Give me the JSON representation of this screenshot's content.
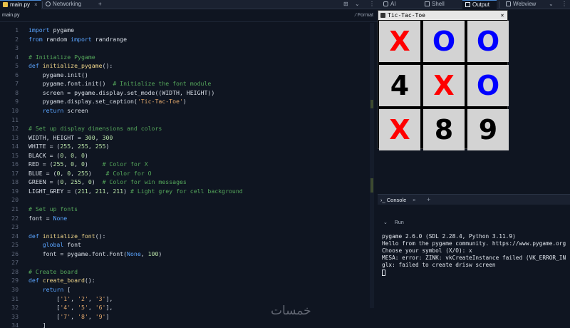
{
  "tabs_left": [
    {
      "label": "main.py",
      "active": true
    },
    {
      "label": "Networking",
      "active": false
    }
  ],
  "tab_add": "+",
  "tabs_right": [
    {
      "label": "AI"
    },
    {
      "label": "Shell"
    },
    {
      "label": "Output"
    },
    {
      "label": "Webview"
    }
  ],
  "tab_close": "×",
  "editor": {
    "file_name": "main.py",
    "format_label": "Format",
    "lines": [
      {
        "n": "1",
        "tokens": [
          {
            "t": "import",
            "c": "kw"
          },
          {
            "t": " pygame",
            "c": ""
          }
        ]
      },
      {
        "n": "2",
        "tokens": [
          {
            "t": "from",
            "c": "kw"
          },
          {
            "t": " random ",
            "c": ""
          },
          {
            "t": "import",
            "c": "kw"
          },
          {
            "t": " randrange",
            "c": ""
          }
        ]
      },
      {
        "n": "3",
        "tokens": []
      },
      {
        "n": "4",
        "tokens": [
          {
            "t": "# Initialize Pygame",
            "c": "cm"
          }
        ]
      },
      {
        "n": "5",
        "tokens": [
          {
            "t": "def",
            "c": "kw"
          },
          {
            "t": " initialize_pygame",
            "c": "fn"
          },
          {
            "t": "():",
            "c": ""
          }
        ]
      },
      {
        "n": "6",
        "tokens": [
          {
            "t": "    pygame.init()",
            "c": ""
          }
        ]
      },
      {
        "n": "7",
        "tokens": [
          {
            "t": "    pygame.font.init()  ",
            "c": ""
          },
          {
            "t": "# Initialize the font module",
            "c": "cm"
          }
        ]
      },
      {
        "n": "8",
        "tokens": [
          {
            "t": "    screen = pygame.display.set_mode((WIDTH, HEIGHT))",
            "c": ""
          }
        ]
      },
      {
        "n": "9",
        "tokens": [
          {
            "t": "    pygame.display.set_caption(",
            "c": ""
          },
          {
            "t": "'Tic-Tac-Toe'",
            "c": "st"
          },
          {
            "t": ")",
            "c": ""
          }
        ]
      },
      {
        "n": "10",
        "tokens": [
          {
            "t": "    ",
            "c": ""
          },
          {
            "t": "return",
            "c": "kw"
          },
          {
            "t": " screen",
            "c": ""
          }
        ]
      },
      {
        "n": "11",
        "tokens": []
      },
      {
        "n": "12",
        "tokens": [
          {
            "t": "# Set up display dimensions and colors",
            "c": "cm"
          }
        ]
      },
      {
        "n": "13",
        "tokens": [
          {
            "t": "WIDTH, HEIGHT = ",
            "c": ""
          },
          {
            "t": "300",
            "c": "nm"
          },
          {
            "t": ", ",
            "c": ""
          },
          {
            "t": "300",
            "c": "nm"
          }
        ]
      },
      {
        "n": "14",
        "tokens": [
          {
            "t": "WHITE = (",
            "c": ""
          },
          {
            "t": "255",
            "c": "nm"
          },
          {
            "t": ", ",
            "c": ""
          },
          {
            "t": "255",
            "c": "nm"
          },
          {
            "t": ", ",
            "c": ""
          },
          {
            "t": "255",
            "c": "nm"
          },
          {
            "t": ")",
            "c": ""
          }
        ]
      },
      {
        "n": "15",
        "tokens": [
          {
            "t": "BLACK = (",
            "c": ""
          },
          {
            "t": "0",
            "c": "nm"
          },
          {
            "t": ", ",
            "c": ""
          },
          {
            "t": "0",
            "c": "nm"
          },
          {
            "t": ", ",
            "c": ""
          },
          {
            "t": "0",
            "c": "nm"
          },
          {
            "t": ")",
            "c": ""
          }
        ]
      },
      {
        "n": "16",
        "tokens": [
          {
            "t": "RED = (",
            "c": ""
          },
          {
            "t": "255",
            "c": "nm"
          },
          {
            "t": ", ",
            "c": ""
          },
          {
            "t": "0",
            "c": "nm"
          },
          {
            "t": ", ",
            "c": ""
          },
          {
            "t": "0",
            "c": "nm"
          },
          {
            "t": ")    ",
            "c": ""
          },
          {
            "t": "# Color for X",
            "c": "cm"
          }
        ]
      },
      {
        "n": "17",
        "tokens": [
          {
            "t": "BLUE = (",
            "c": ""
          },
          {
            "t": "0",
            "c": "nm"
          },
          {
            "t": ", ",
            "c": ""
          },
          {
            "t": "0",
            "c": "nm"
          },
          {
            "t": ", ",
            "c": ""
          },
          {
            "t": "255",
            "c": "nm"
          },
          {
            "t": ")    ",
            "c": ""
          },
          {
            "t": "# Color for O",
            "c": "cm"
          }
        ]
      },
      {
        "n": "18",
        "tokens": [
          {
            "t": "GREEN = (",
            "c": ""
          },
          {
            "t": "0",
            "c": "nm"
          },
          {
            "t": ", ",
            "c": ""
          },
          {
            "t": "255",
            "c": "nm"
          },
          {
            "t": ", ",
            "c": ""
          },
          {
            "t": "0",
            "c": "nm"
          },
          {
            "t": ")  ",
            "c": ""
          },
          {
            "t": "# Color for win messages",
            "c": "cm"
          }
        ]
      },
      {
        "n": "19",
        "tokens": [
          {
            "t": "LIGHT_GREY = (",
            "c": ""
          },
          {
            "t": "211",
            "c": "nm"
          },
          {
            "t": ", ",
            "c": ""
          },
          {
            "t": "211",
            "c": "nm"
          },
          {
            "t": ", ",
            "c": ""
          },
          {
            "t": "211",
            "c": "nm"
          },
          {
            "t": ") ",
            "c": ""
          },
          {
            "t": "# Light grey for cell background",
            "c": "cm"
          }
        ]
      },
      {
        "n": "20",
        "tokens": []
      },
      {
        "n": "21",
        "tokens": [
          {
            "t": "# Set up fonts",
            "c": "cm"
          }
        ]
      },
      {
        "n": "22",
        "tokens": [
          {
            "t": "font = ",
            "c": ""
          },
          {
            "t": "None",
            "c": "kw"
          }
        ]
      },
      {
        "n": "23",
        "tokens": []
      },
      {
        "n": "24",
        "tokens": [
          {
            "t": "def",
            "c": "kw"
          },
          {
            "t": " initialize_font",
            "c": "fn"
          },
          {
            "t": "():",
            "c": ""
          }
        ]
      },
      {
        "n": "25",
        "tokens": [
          {
            "t": "    ",
            "c": ""
          },
          {
            "t": "global",
            "c": "kw"
          },
          {
            "t": " font",
            "c": ""
          }
        ]
      },
      {
        "n": "26",
        "tokens": [
          {
            "t": "    font = pygame.font.Font(",
            "c": ""
          },
          {
            "t": "None",
            "c": "kw"
          },
          {
            "t": ", ",
            "c": ""
          },
          {
            "t": "100",
            "c": "nm"
          },
          {
            "t": ")",
            "c": ""
          }
        ]
      },
      {
        "n": "27",
        "tokens": []
      },
      {
        "n": "28",
        "tokens": [
          {
            "t": "# Create board",
            "c": "cm"
          }
        ]
      },
      {
        "n": "29",
        "tokens": [
          {
            "t": "def",
            "c": "kw"
          },
          {
            "t": " create_board",
            "c": "fn"
          },
          {
            "t": "():",
            "c": ""
          }
        ]
      },
      {
        "n": "30",
        "tokens": [
          {
            "t": "    ",
            "c": ""
          },
          {
            "t": "return",
            "c": "kw"
          },
          {
            "t": " [",
            "c": ""
          }
        ]
      },
      {
        "n": "31",
        "tokens": [
          {
            "t": "        [",
            "c": ""
          },
          {
            "t": "'1'",
            "c": "st"
          },
          {
            "t": ", ",
            "c": ""
          },
          {
            "t": "'2'",
            "c": "st"
          },
          {
            "t": ", ",
            "c": ""
          },
          {
            "t": "'3'",
            "c": "st"
          },
          {
            "t": "],",
            "c": ""
          }
        ]
      },
      {
        "n": "32",
        "tokens": [
          {
            "t": "        [",
            "c": ""
          },
          {
            "t": "'4'",
            "c": "st"
          },
          {
            "t": ", ",
            "c": ""
          },
          {
            "t": "'5'",
            "c": "st"
          },
          {
            "t": ", ",
            "c": ""
          },
          {
            "t": "'6'",
            "c": "st"
          },
          {
            "t": "],",
            "c": ""
          }
        ]
      },
      {
        "n": "33",
        "tokens": [
          {
            "t": "        [",
            "c": ""
          },
          {
            "t": "'7'",
            "c": "st"
          },
          {
            "t": ", ",
            "c": ""
          },
          {
            "t": "'8'",
            "c": "st"
          },
          {
            "t": ", ",
            "c": ""
          },
          {
            "t": "'9'",
            "c": "st"
          },
          {
            "t": "]",
            "c": ""
          }
        ]
      },
      {
        "n": "34",
        "tokens": [
          {
            "t": "    ]",
            "c": ""
          }
        ]
      }
    ]
  },
  "game": {
    "title": "Tic-Tac-Toe",
    "close": "×",
    "cells": [
      {
        "mark": "X",
        "color": "red"
      },
      {
        "mark": "O",
        "color": "blue"
      },
      {
        "mark": "O",
        "color": "blue"
      },
      {
        "mark": "4",
        "color": "black"
      },
      {
        "mark": "X",
        "color": "red"
      },
      {
        "mark": "O",
        "color": "blue"
      },
      {
        "mark": "X",
        "color": "red"
      },
      {
        "mark": "8",
        "color": "black"
      },
      {
        "mark": "9",
        "color": "black"
      }
    ]
  },
  "console": {
    "title": "Console",
    "close": "×",
    "add": "+",
    "run_label": "Run",
    "output": [
      "pygame 2.6.0 (SDL 2.28.4, Python 3.11.9)",
      "Hello from the pygame community. https://www.pygame.org",
      "Choose your symbol (X/O): x",
      "MESA: error: ZINK: vkCreateInstance failed (VK_ERROR_IN",
      "glx: failed to create drisw screen"
    ]
  },
  "watermark": "خمسات",
  "colors": {
    "x_mark": "#ff0000",
    "o_mark": "#0000ff",
    "cell_bg": "#d3d3d3",
    "editor_bg": "#0f1521"
  }
}
